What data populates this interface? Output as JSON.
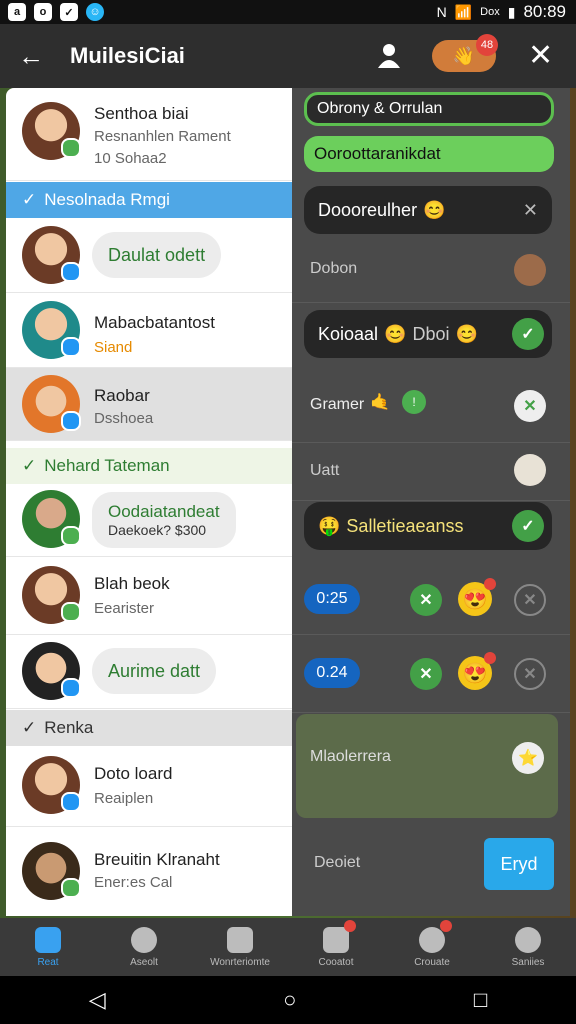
{
  "status": {
    "time": "80:89",
    "carrier": "Dox"
  },
  "appbar": {
    "title": "MuilesiCiai",
    "badge": "48"
  },
  "left": {
    "rows": [
      {
        "name": "Senthoa biai",
        "line1": "Resnanhlen Rament",
        "line2": "10 Sohaa2"
      },
      {
        "bubble": "Daulat odett"
      },
      {
        "name": "Mabacbatantost",
        "sub": "Siand"
      },
      {
        "name": "Raobar",
        "sub": "Dsshoea"
      },
      {
        "bubble1": "Oodaiatandeat",
        "bubble2": "Daekoek?  $300"
      },
      {
        "name": "Blah beok",
        "sub": "Eearister"
      },
      {
        "bubble": "Aurime datt"
      },
      {
        "name": "Doto loard",
        "sub": "Reaiplen"
      },
      {
        "name": "Breuitin Klranaht",
        "sub": "Ener:es Cal"
      }
    ],
    "sections": [
      {
        "label": "Nesolnada Rmgi"
      },
      {
        "label": "Nehard Tateman"
      },
      {
        "label": "Renka"
      }
    ]
  },
  "right": {
    "top_input": "Obrony & Orrulan",
    "green_pill": "Ooroottaranikdat",
    "dark_card": "Doooreulher",
    "row_dobon": "Dobon",
    "koioaal": "Koioaal",
    "koioaal_extra": "Dboi",
    "gramer": "Gramer",
    "uatt": "Uatt",
    "saliet": "Salletieaeanss",
    "time1": "0:25",
    "time2": "0.24",
    "mlaolerrera": "Mlaolerrera",
    "deoiet": "Deoiet",
    "send": "Eryd"
  },
  "bottom_nav": [
    {
      "label": "Reat",
      "active": true
    },
    {
      "label": "Aseolt"
    },
    {
      "label": "Wonrteriomte"
    },
    {
      "label": "Cooatot"
    },
    {
      "label": "Crouate"
    },
    {
      "label": "Saniies"
    }
  ]
}
